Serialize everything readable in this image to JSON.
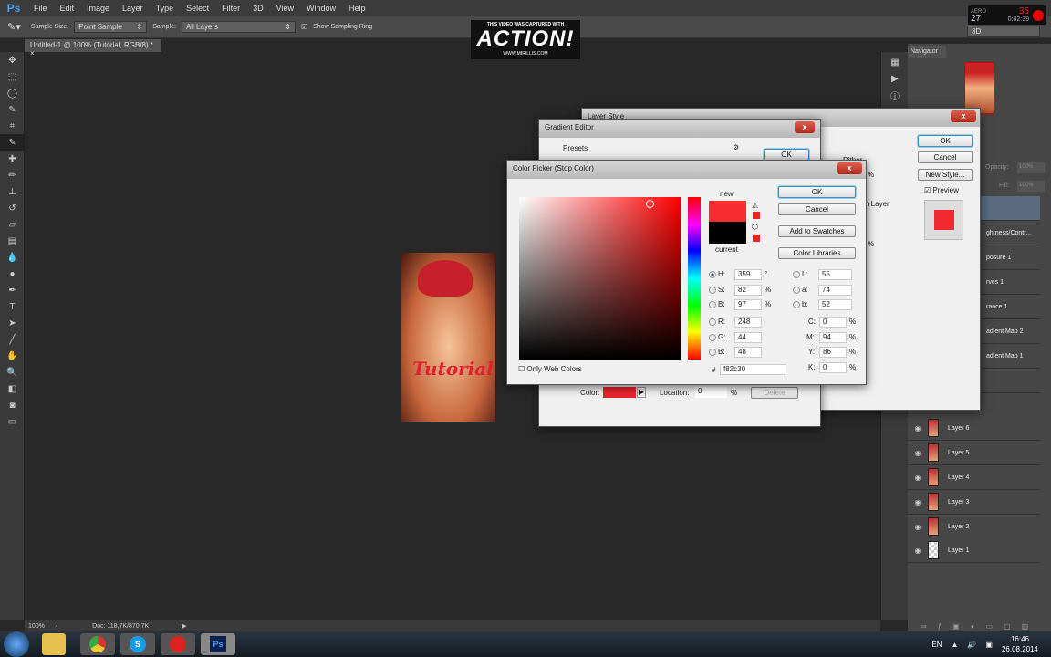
{
  "menubar": {
    "logo": "Ps",
    "items": [
      "File",
      "Edit",
      "Image",
      "Layer",
      "Type",
      "Select",
      "Filter",
      "3D",
      "View",
      "Window",
      "Help"
    ]
  },
  "options": {
    "sample_size_label": "Sample Size:",
    "sample_size_value": "Point Sample",
    "sample_label": "Sample:",
    "sample_value": "All Layers",
    "show_ring": "Show Sampling Ring",
    "workspace": "3D"
  },
  "document_tab": {
    "title": "Untitled-1 @ 100% (Tutorial, RGB/8) *",
    "close": "×"
  },
  "watermark": {
    "line1": "THIS VIDEO WAS CAPTURED WITH",
    "brand": "ACTION!",
    "url": "WWW.MIRILLIS.COM"
  },
  "recorder": {
    "mode": "AERO",
    "fps": "27",
    "counter": "35",
    "time": "0:02:39"
  },
  "canvas": {
    "image_text": "Tutorial"
  },
  "statusbar": {
    "zoom": "100%",
    "doc": "Doc: 118,7K/870,7K"
  },
  "navigator": {
    "tab": "Navigator"
  },
  "layers_panel": {
    "opacity_label": "Opacity:",
    "opacity_value": "100%",
    "fill_label": "Fill:",
    "fill_value": "100%",
    "rows": [
      "",
      "ghtness/Contr...",
      "posure 1",
      "rves 1",
      "rance 1",
      "adient Map 2",
      "adient Map 1",
      "",
      "",
      "Layer 6",
      "Layer 5",
      "Layer 4",
      "Layer 3",
      "Layer 2",
      "Layer 1"
    ]
  },
  "layer_style": {
    "title": "Layer Style",
    "ok": "OK",
    "cancel": "Cancel",
    "new_style": "New Style...",
    "preview": "Preview",
    "dither": "Dither",
    "with_layer": "h Layer",
    "pct1": "%",
    "pct2": "%",
    "preview_color": "#f02a30"
  },
  "gradient_editor": {
    "title": "Gradient Editor",
    "presets": "Presets",
    "ok": "OK",
    "color_label": "Color:",
    "location_label": "Location:",
    "location_value": "0",
    "pct": "%",
    "delete": "Delete",
    "stop_color": "#e8242c"
  },
  "color_picker": {
    "title": "Color Picker (Stop Color)",
    "ok": "OK",
    "cancel": "Cancel",
    "add_swatches": "Add to Swatches",
    "color_libraries": "Color Libraries",
    "new_label": "new",
    "current_label": "current",
    "new_color": "#f82c30",
    "current_color": "#000000",
    "only_web": "Only Web Colors",
    "hsb": [
      {
        "l": "H:",
        "v": "359",
        "u": "°"
      },
      {
        "l": "S:",
        "v": "82",
        "u": "%"
      },
      {
        "l": "B:",
        "v": "97",
        "u": "%"
      }
    ],
    "rgb": [
      {
        "l": "R:",
        "v": "248"
      },
      {
        "l": "G:",
        "v": "44"
      },
      {
        "l": "B:",
        "v": "48"
      }
    ],
    "lab": [
      {
        "l": "L:",
        "v": "55"
      },
      {
        "l": "a:",
        "v": "74"
      },
      {
        "l": "b:",
        "v": "52"
      }
    ],
    "cmyk": [
      {
        "l": "C:",
        "v": "0",
        "u": "%"
      },
      {
        "l": "M:",
        "v": "94",
        "u": "%"
      },
      {
        "l": "Y:",
        "v": "86",
        "u": "%"
      },
      {
        "l": "K:",
        "v": "0",
        "u": "%"
      }
    ],
    "hex_label": "#",
    "hex": "f82c30"
  },
  "taskbar": {
    "apps": [
      "Explorer",
      "Chrome",
      "Skype",
      "Recorder",
      "Photoshop"
    ],
    "ps": "Ps",
    "lang": "EN",
    "time": "16:46",
    "date": "26.08.2014"
  }
}
